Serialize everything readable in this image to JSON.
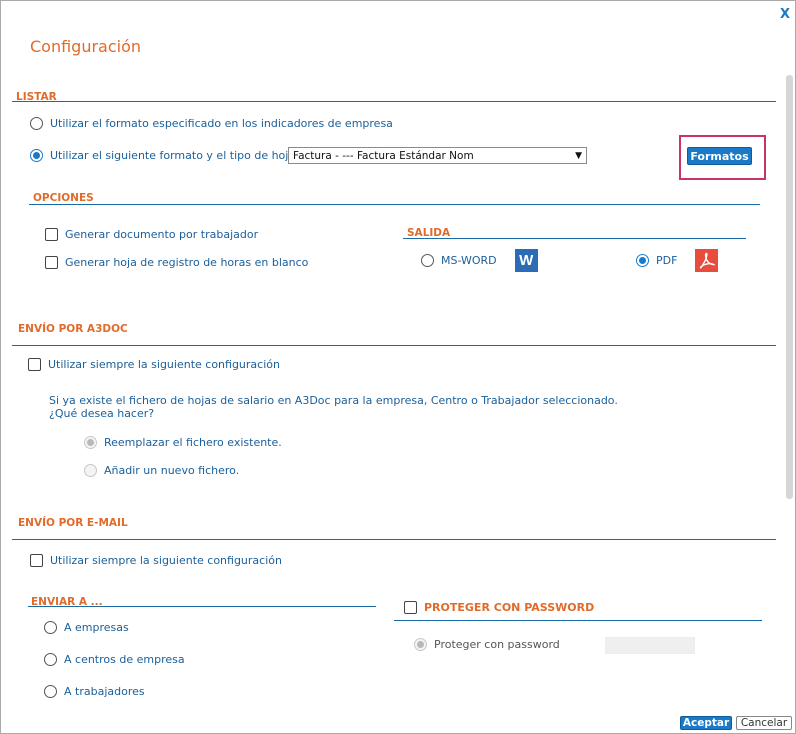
{
  "dialog": {
    "title": "Configuración",
    "close_label": "X"
  },
  "listar": {
    "section_title": "LISTAR",
    "option_indicadores": "Utilizar el formato especificado en los indicadores de empresa",
    "option_siguiente": "Utilizar el siguiente formato y el tipo de hoja",
    "selected_option": "siguiente",
    "format_select_value": "Factura - --- Factura Estándar Nom",
    "formatos_button": "Formatos"
  },
  "opciones": {
    "section_title": "OPCIONES",
    "check_documento": "Generar documento por trabajador",
    "check_documento_checked": false,
    "check_hoja_blanco": "Generar hoja de registro de horas en blanco",
    "check_hoja_blanco_checked": false
  },
  "salida": {
    "section_title": "SALIDA",
    "option_word": "MS-WORD",
    "option_pdf": "PDF",
    "selected": "PDF",
    "word_icon_letter": "W"
  },
  "a3doc": {
    "section_title": "ENVÍO POR A3DOC",
    "check_config": "Utilizar siempre la siguiente configuración",
    "check_config_checked": false,
    "question_line1": "Si ya existe el fichero de hojas de salario en A3Doc para la empresa, Centro o Trabajador seleccionado.",
    "question_line2": "¿Qué desea hacer?",
    "option_reemplazar": "Reemplazar el fichero existente.",
    "option_anadir": "Añadir un nuevo fichero.",
    "selected": "reemplazar"
  },
  "email": {
    "section_title": "ENVÍO POR E-MAIL",
    "check_config": "Utilizar siempre la siguiente configuración",
    "check_config_checked": false,
    "enviar_title": "ENVIAR A ...",
    "option_empresas": "A empresas",
    "option_centros": "A centros de empresa",
    "option_trabajadores": "A trabajadores",
    "proteger_title": "PROTEGER CON PASSWORD",
    "proteger_option": "Proteger con password",
    "password_value": ""
  },
  "footer": {
    "accept_button": "Aceptar",
    "cancel_button": "Cancelar"
  },
  "colors": {
    "accent_orange": "#e06b2a",
    "link_blue": "#1a5f9a",
    "primary_button": "#1a7ac8",
    "highlight_border": "#c8336a",
    "word_icon": "#2b6cb5",
    "pdf_icon": "#e84c3d"
  }
}
